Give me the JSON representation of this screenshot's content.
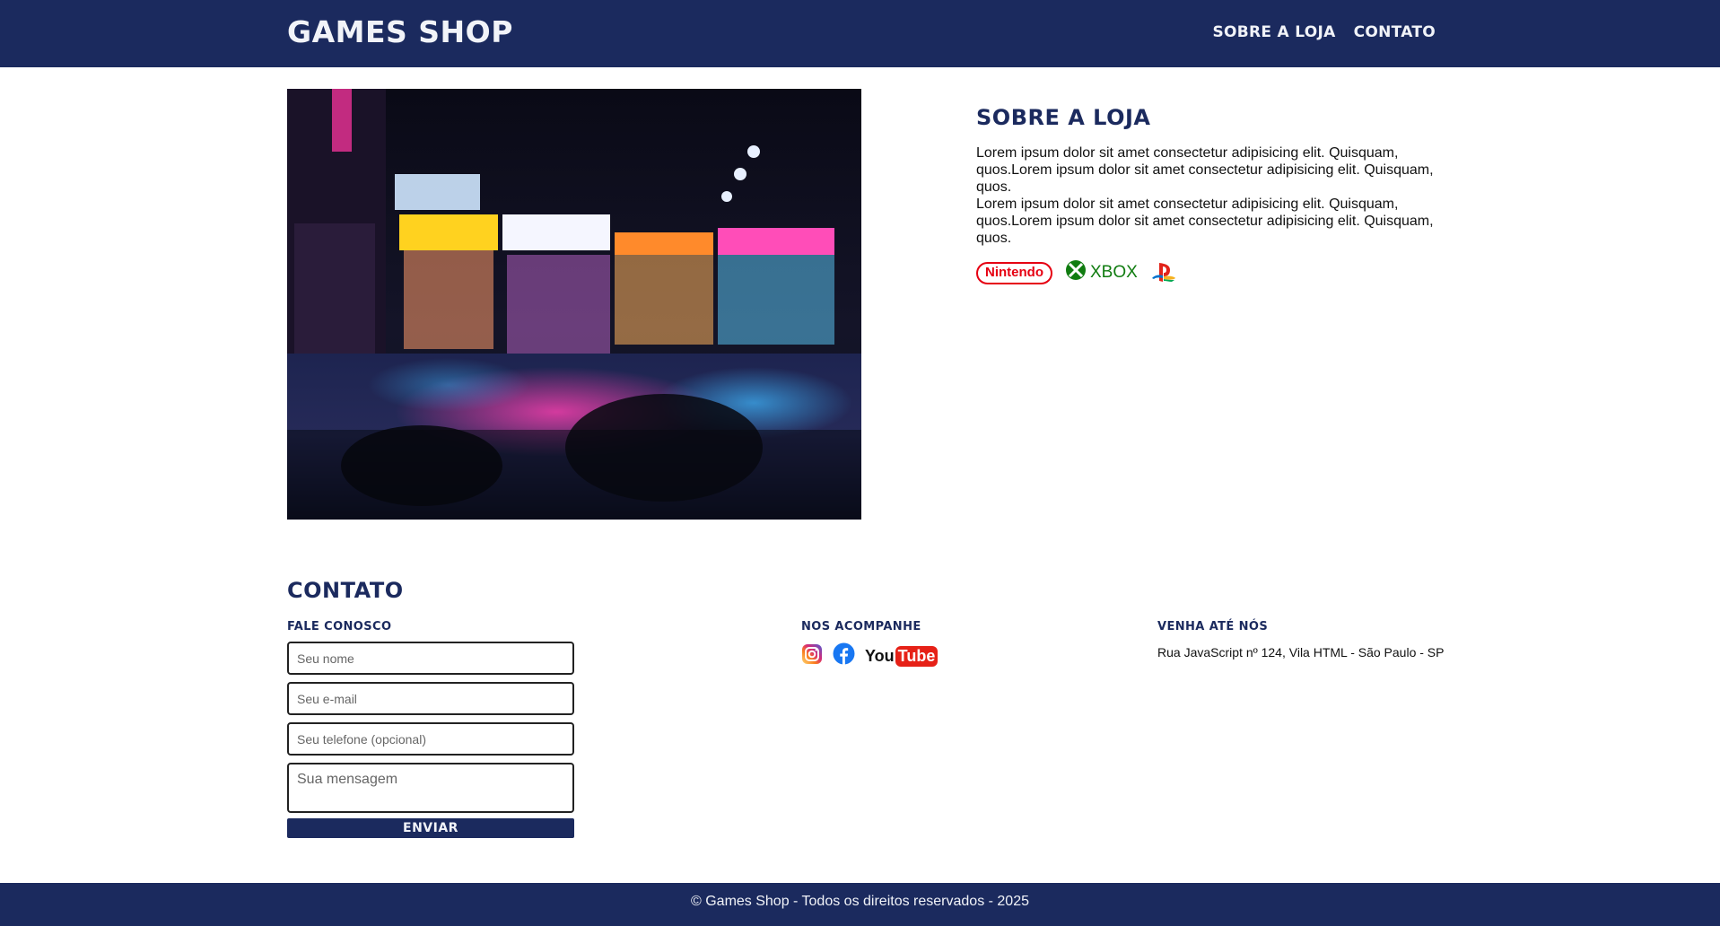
{
  "header": {
    "brand": "GAMES SHOP",
    "nav": [
      {
        "label": "SOBRE A LOJA"
      },
      {
        "label": "CONTATO"
      }
    ]
  },
  "about": {
    "title": "SOBRE A LOJA",
    "paragraph_1": "Lorem ipsum dolor sit amet consectetur adipisicing elit. Quisquam, quos.Lorem ipsum dolor sit amet consectetur adipisicing elit. Quisquam, quos.",
    "paragraph_2": "Lorem ipsum dolor sit amet consectetur adipisicing elit. Quisquam, quos.Lorem ipsum dolor sit amet consectetur adipisicing elit. Quisquam, quos.",
    "brands": {
      "nintendo": "Nintendo",
      "xbox": "XBOX",
      "playstation_icon": "playstation-icon"
    },
    "hero_image": "neon-night-street-photo"
  },
  "contact": {
    "title": "CONTATO",
    "form": {
      "heading": "FALE CONOSCO",
      "name_placeholder": "Seu nome",
      "email_placeholder": "Seu e-mail",
      "phone_placeholder": "Seu telefone (opcional)",
      "message_placeholder": "Sua mensagem",
      "submit_label": "ENVIAR"
    },
    "social": {
      "heading": "NOS ACOMPANHE",
      "icons": [
        "instagram-icon",
        "facebook-icon",
        "youtube-icon"
      ],
      "youtube_text": "You",
      "youtube_box": "Tube"
    },
    "visit": {
      "heading": "VENHA ATÉ NÓS",
      "address": "Rua JavaScript nº 124, Vila HTML - São Paulo - SP"
    }
  },
  "footer": {
    "text": "© Games Shop - Todos os direitos reservados - 2025"
  },
  "colors": {
    "primary": "#1b2a5e",
    "light_text": "#f1f3f8",
    "nintendo_red": "#e60012",
    "xbox_green": "#107c10",
    "facebook_blue": "#1877f2",
    "youtube_red": "#e62117"
  }
}
